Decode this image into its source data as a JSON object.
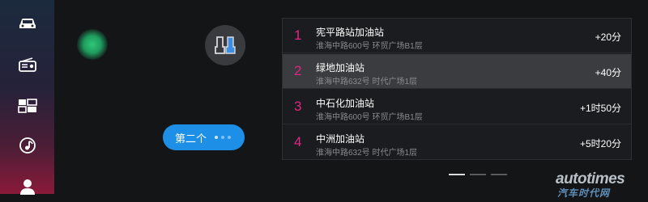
{
  "sidebar": {
    "items": [
      {
        "icon": "car-icon"
      },
      {
        "icon": "radio-icon"
      },
      {
        "icon": "apps-grid-icon"
      },
      {
        "icon": "music-icon"
      },
      {
        "icon": "user-icon"
      }
    ]
  },
  "seat_button": {
    "icon": "seats-icon"
  },
  "pill": {
    "label": "第二个"
  },
  "stations": [
    {
      "num": "1",
      "name": "宪平路站加油站",
      "address": "淮海中路600号 环贸广场B1层",
      "extra_time": "+20分"
    },
    {
      "num": "2",
      "name": "绿地加油站",
      "address": "淮海中路632号 时代广场1层",
      "extra_time": "+40分"
    },
    {
      "num": "3",
      "name": "中石化加油站",
      "address": "淮海中路600号 环贸广场B1层",
      "extra_time": "+1时50分"
    },
    {
      "num": "4",
      "name": "中洲加油站",
      "address": "淮海中路632号 时代广场1层",
      "extra_time": "+5时20分"
    }
  ],
  "watermark": {
    "text": "autotimes",
    "sub": "汽车时代网"
  },
  "colors": {
    "accent": "#e0277f",
    "pill": "#1e8fe6",
    "selected_row": "#3b3c40"
  }
}
